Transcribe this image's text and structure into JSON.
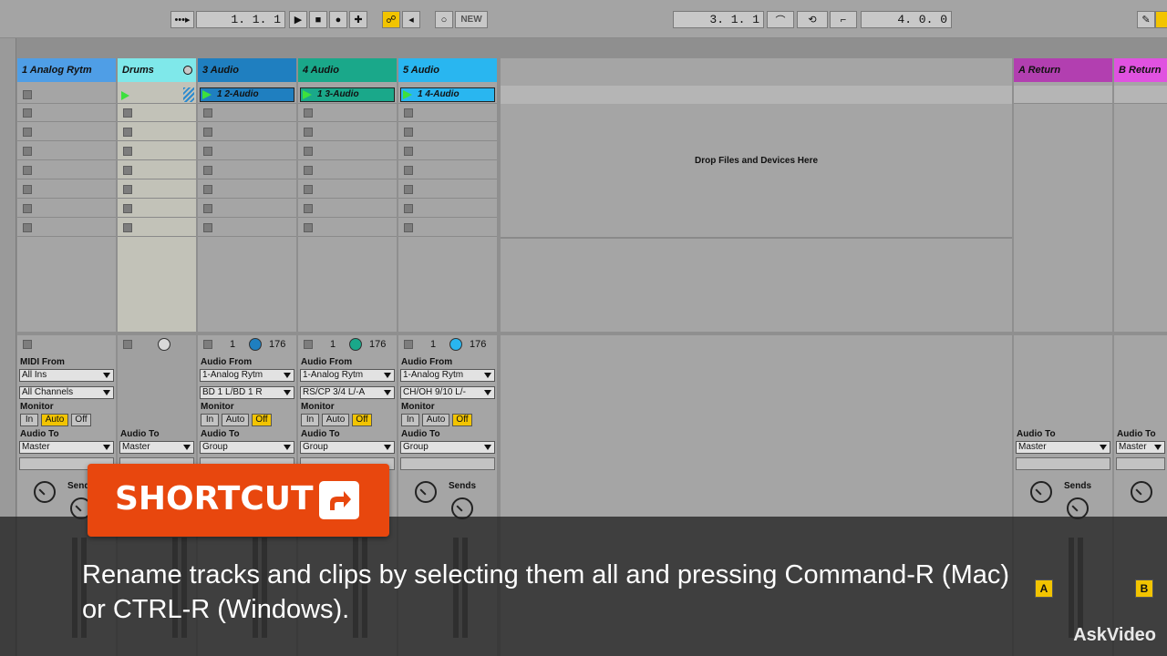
{
  "toolbar": {
    "follow_icon": "metronome-follow-icon",
    "arrangement_position": "1.  1.  1",
    "loop_start": "3.  1.  1",
    "loop_length": "4.  0.  0",
    "new_label": "NEW"
  },
  "tracks": [
    {
      "name": "1 Analog Rytm",
      "color": "#4f9ee6",
      "type": "midi",
      "input_label": "MIDI From",
      "input": "All Ins",
      "channel": "All Channels",
      "monitor": "Auto"
    },
    {
      "name": "Drums",
      "color": "#7fe8ea",
      "type": "group"
    },
    {
      "name": "3 Audio",
      "color": "#1f7fc0",
      "type": "audio",
      "clip": "1 2-Audio",
      "input_label": "Audio From",
      "input": "1-Analog Rytm",
      "channel": "BD 1 L/BD 1 R",
      "monitor": "Off",
      "output": "Group",
      "left_num": "1",
      "right_num": "176"
    },
    {
      "name": "4 Audio",
      "color": "#1aa88a",
      "type": "audio",
      "clip": "1 3-Audio",
      "input_label": "Audio From",
      "input": "1-Analog Rytm",
      "channel": "RS/CP 3/4 L/-A",
      "monitor": "Off",
      "output": "Group",
      "left_num": "1",
      "right_num": "176"
    },
    {
      "name": "5 Audio",
      "color": "#29b6f0",
      "type": "audio",
      "clip": "1 4-Audio",
      "input_label": "Audio From",
      "input": "1-Analog Rytm",
      "channel": "CH/OH 9/10 L/-",
      "monitor": "Off",
      "output": "Group",
      "left_num": "1",
      "right_num": "176"
    }
  ],
  "returns": [
    {
      "name": "A Return",
      "color": "#b23fb0",
      "output": "Master"
    },
    {
      "name": "B Return",
      "color": "#e052e0",
      "output": "Master"
    }
  ],
  "labels": {
    "monitor": "Monitor",
    "audio_to": "Audio To",
    "master": "Master",
    "sends": "Sends",
    "mon_in": "In",
    "mon_auto": "Auto",
    "mon_off": "Off",
    "drop_zone": "Drop Files and Devices Here",
    "send_a": "A",
    "send_b": "B"
  },
  "overlay": {
    "badge": "SHORTCUT",
    "badge_icon": "share-arrow-icon",
    "caption_line1": "Rename tracks and clips by selecting them all and pressing Command-R (Mac)",
    "caption_line2": "or CTRL-R (Windows).",
    "brand": "AskVideo"
  }
}
